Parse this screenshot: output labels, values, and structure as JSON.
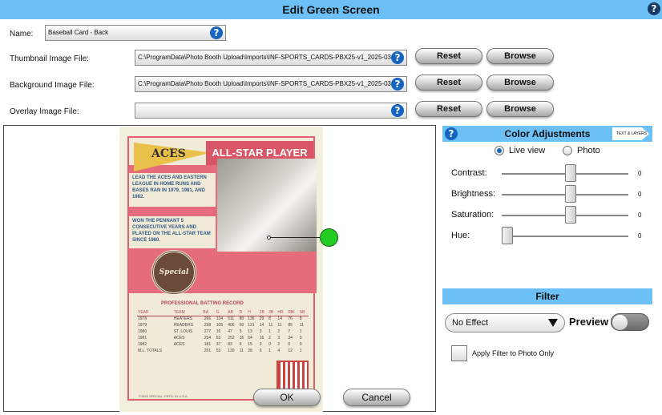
{
  "window": {
    "title": "Edit Green Screen",
    "help_icon": "help-icon"
  },
  "form": {
    "name_label": "Name:",
    "name_value": "Baseball Card - Back",
    "thumbnail_label": "Thumbnail Image File:",
    "thumbnail_value": "C:\\ProgramData\\Photo Booth Upload\\Imports\\INF-SPORTS_CARDS-PBX25-v1_2025-03",
    "background_label": "Background Image File:",
    "background_value": "C:\\ProgramData\\Photo Booth Upload\\Imports\\INF-SPORTS_CARDS-PBX25-v1_2025-03",
    "overlay_label": "Overlay Image File:",
    "overlay_value": "",
    "reset_label": "Reset",
    "browse_label": "Browse"
  },
  "card": {
    "team": "ACES",
    "banner": "ALL-STAR PLAYER",
    "blurb1": "LEAD THE ACES AND EASTERN LEAGUE IN HOME RUNS AND BASES RAN IN 1979, 1981, AND 1982.",
    "blurb2": "WON THE PENNANT 5 CONSECUTIVE YEARS AND PLAYED ON THE ALL-STAR TEAM SINCE 1980.",
    "seal_top": "BASEBALL",
    "seal_main": "Special",
    "seal_bottom": "EDITION",
    "stats_title": "PROFESSIONAL BATTING RECORD",
    "stats_headers": [
      "YEAR",
      "TEAM",
      "BA",
      "G",
      "AB",
      "R",
      "H",
      "2B",
      "3B",
      "HR",
      "RBI",
      "SB"
    ],
    "stats_rows": [
      [
        "1978",
        "HEATERS",
        ".266",
        "134",
        "511",
        "80",
        "136",
        "29",
        "8",
        "14",
        "76",
        "8"
      ],
      [
        "1979",
        "HEADERS",
        ".298",
        "105",
        "406",
        "60",
        "121",
        "14",
        "11",
        "11",
        "85",
        "11"
      ],
      [
        "1980",
        "ST. LOUIS",
        ".277",
        "16",
        "47",
        "5",
        "13",
        "3",
        "1",
        "2",
        "7",
        "1"
      ],
      [
        "1981",
        "ACES",
        ".254",
        "63",
        "252",
        "35",
        "64",
        "16",
        "2",
        "3",
        "34",
        "0"
      ],
      [
        "1982",
        "ACES",
        ".181",
        "37",
        "83",
        "6",
        "15",
        "3",
        "0",
        "2",
        "5",
        "0"
      ],
      [
        "M.L. TOTALS",
        "",
        ".251",
        "53",
        "130",
        "11",
        "28",
        "6",
        "1",
        "4",
        "12",
        "1"
      ]
    ],
    "copyright": "©1993 SPECIAL. PRTD. IN U.S.A."
  },
  "dialog": {
    "ok_label": "OK",
    "cancel_label": "Cancel"
  },
  "color_adjustments": {
    "title": "Color Adjustments",
    "tag": "TEXT & LAYERS",
    "live_view_label": "Live view",
    "photo_label": "Photo",
    "selected_mode": "Live view",
    "sliders": [
      {
        "label": "Contrast:",
        "value": "0",
        "level": 0.5
      },
      {
        "label": "Brightness:",
        "value": "0",
        "level": 0.5
      },
      {
        "label": "Saturation:",
        "value": "0",
        "level": 0.5
      },
      {
        "label": "Hue:",
        "value": "0",
        "level": 0.0
      }
    ]
  },
  "filter": {
    "title": "Filter",
    "selected": "No Effect",
    "preview_label": "Preview",
    "preview_on": false,
    "apply_label": "Apply Filter to Photo Only",
    "apply_checked": false
  },
  "colors": {
    "header_blue": "#6cc0f5",
    "help_blue": "#1565c0",
    "green_handle": "#22cc22",
    "card_red": "#d85666"
  }
}
